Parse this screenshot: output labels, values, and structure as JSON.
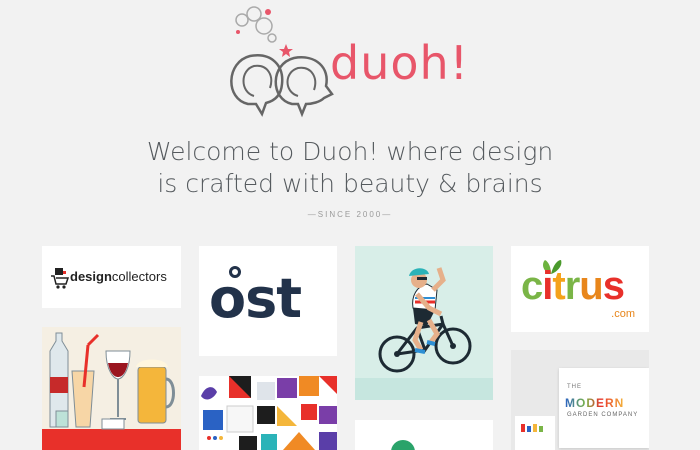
{
  "brand": {
    "wordmark": "duoh!",
    "accent_color": "#e8566a",
    "logo_icon": "speech-bubbles-icon"
  },
  "hero": {
    "line1": "Welcome to Duoh! where design",
    "line2": "is crafted with beauty & brains",
    "since": "—SINCE 2000—"
  },
  "portfolio": {
    "design_collectors": {
      "bold": "design",
      "rest": "collectors"
    },
    "ost": {
      "text": "ost"
    },
    "citrus": {
      "letters": [
        "c",
        "i",
        "t",
        "r",
        "u",
        "s"
      ],
      "domain": ".com"
    },
    "modern_garden": {
      "the": "THE",
      "name": "MODERN",
      "sub": "GARDEN COMPANY"
    }
  }
}
